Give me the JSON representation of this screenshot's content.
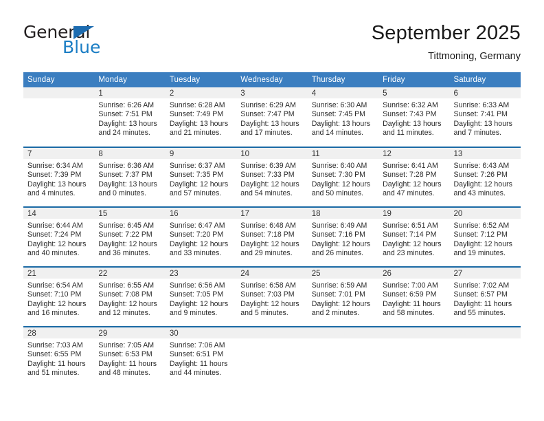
{
  "brand": {
    "name_top": "General",
    "name_bottom": "Blue",
    "triangle_icon": "triangle-icon",
    "color_dark": "#231f20",
    "color_blue": "#1a7dc4"
  },
  "header": {
    "title": "September 2025",
    "subtitle": "Tittmoning, Germany"
  },
  "theme": {
    "header_bg": "#3b7ec0",
    "row_border": "#1b6aa5",
    "daynum_bg": "#f0f0f0"
  },
  "weekdays": [
    "Sunday",
    "Monday",
    "Tuesday",
    "Wednesday",
    "Thursday",
    "Friday",
    "Saturday"
  ],
  "weeks": [
    [
      {
        "day": "",
        "sunrise": "",
        "sunset": "",
        "daylight1": "",
        "daylight2": "",
        "empty": true
      },
      {
        "day": "1",
        "sunrise": "Sunrise: 6:26 AM",
        "sunset": "Sunset: 7:51 PM",
        "daylight1": "Daylight: 13 hours",
        "daylight2": "and 24 minutes."
      },
      {
        "day": "2",
        "sunrise": "Sunrise: 6:28 AM",
        "sunset": "Sunset: 7:49 PM",
        "daylight1": "Daylight: 13 hours",
        "daylight2": "and 21 minutes."
      },
      {
        "day": "3",
        "sunrise": "Sunrise: 6:29 AM",
        "sunset": "Sunset: 7:47 PM",
        "daylight1": "Daylight: 13 hours",
        "daylight2": "and 17 minutes."
      },
      {
        "day": "4",
        "sunrise": "Sunrise: 6:30 AM",
        "sunset": "Sunset: 7:45 PM",
        "daylight1": "Daylight: 13 hours",
        "daylight2": "and 14 minutes."
      },
      {
        "day": "5",
        "sunrise": "Sunrise: 6:32 AM",
        "sunset": "Sunset: 7:43 PM",
        "daylight1": "Daylight: 13 hours",
        "daylight2": "and 11 minutes."
      },
      {
        "day": "6",
        "sunrise": "Sunrise: 6:33 AM",
        "sunset": "Sunset: 7:41 PM",
        "daylight1": "Daylight: 13 hours",
        "daylight2": "and 7 minutes."
      }
    ],
    [
      {
        "day": "7",
        "sunrise": "Sunrise: 6:34 AM",
        "sunset": "Sunset: 7:39 PM",
        "daylight1": "Daylight: 13 hours",
        "daylight2": "and 4 minutes."
      },
      {
        "day": "8",
        "sunrise": "Sunrise: 6:36 AM",
        "sunset": "Sunset: 7:37 PM",
        "daylight1": "Daylight: 13 hours",
        "daylight2": "and 0 minutes."
      },
      {
        "day": "9",
        "sunrise": "Sunrise: 6:37 AM",
        "sunset": "Sunset: 7:35 PM",
        "daylight1": "Daylight: 12 hours",
        "daylight2": "and 57 minutes."
      },
      {
        "day": "10",
        "sunrise": "Sunrise: 6:39 AM",
        "sunset": "Sunset: 7:33 PM",
        "daylight1": "Daylight: 12 hours",
        "daylight2": "and 54 minutes."
      },
      {
        "day": "11",
        "sunrise": "Sunrise: 6:40 AM",
        "sunset": "Sunset: 7:30 PM",
        "daylight1": "Daylight: 12 hours",
        "daylight2": "and 50 minutes."
      },
      {
        "day": "12",
        "sunrise": "Sunrise: 6:41 AM",
        "sunset": "Sunset: 7:28 PM",
        "daylight1": "Daylight: 12 hours",
        "daylight2": "and 47 minutes."
      },
      {
        "day": "13",
        "sunrise": "Sunrise: 6:43 AM",
        "sunset": "Sunset: 7:26 PM",
        "daylight1": "Daylight: 12 hours",
        "daylight2": "and 43 minutes."
      }
    ],
    [
      {
        "day": "14",
        "sunrise": "Sunrise: 6:44 AM",
        "sunset": "Sunset: 7:24 PM",
        "daylight1": "Daylight: 12 hours",
        "daylight2": "and 40 minutes."
      },
      {
        "day": "15",
        "sunrise": "Sunrise: 6:45 AM",
        "sunset": "Sunset: 7:22 PM",
        "daylight1": "Daylight: 12 hours",
        "daylight2": "and 36 minutes."
      },
      {
        "day": "16",
        "sunrise": "Sunrise: 6:47 AM",
        "sunset": "Sunset: 7:20 PM",
        "daylight1": "Daylight: 12 hours",
        "daylight2": "and 33 minutes."
      },
      {
        "day": "17",
        "sunrise": "Sunrise: 6:48 AM",
        "sunset": "Sunset: 7:18 PM",
        "daylight1": "Daylight: 12 hours",
        "daylight2": "and 29 minutes."
      },
      {
        "day": "18",
        "sunrise": "Sunrise: 6:49 AM",
        "sunset": "Sunset: 7:16 PM",
        "daylight1": "Daylight: 12 hours",
        "daylight2": "and 26 minutes."
      },
      {
        "day": "19",
        "sunrise": "Sunrise: 6:51 AM",
        "sunset": "Sunset: 7:14 PM",
        "daylight1": "Daylight: 12 hours",
        "daylight2": "and 23 minutes."
      },
      {
        "day": "20",
        "sunrise": "Sunrise: 6:52 AM",
        "sunset": "Sunset: 7:12 PM",
        "daylight1": "Daylight: 12 hours",
        "daylight2": "and 19 minutes."
      }
    ],
    [
      {
        "day": "21",
        "sunrise": "Sunrise: 6:54 AM",
        "sunset": "Sunset: 7:10 PM",
        "daylight1": "Daylight: 12 hours",
        "daylight2": "and 16 minutes."
      },
      {
        "day": "22",
        "sunrise": "Sunrise: 6:55 AM",
        "sunset": "Sunset: 7:08 PM",
        "daylight1": "Daylight: 12 hours",
        "daylight2": "and 12 minutes."
      },
      {
        "day": "23",
        "sunrise": "Sunrise: 6:56 AM",
        "sunset": "Sunset: 7:05 PM",
        "daylight1": "Daylight: 12 hours",
        "daylight2": "and 9 minutes."
      },
      {
        "day": "24",
        "sunrise": "Sunrise: 6:58 AM",
        "sunset": "Sunset: 7:03 PM",
        "daylight1": "Daylight: 12 hours",
        "daylight2": "and 5 minutes."
      },
      {
        "day": "25",
        "sunrise": "Sunrise: 6:59 AM",
        "sunset": "Sunset: 7:01 PM",
        "daylight1": "Daylight: 12 hours",
        "daylight2": "and 2 minutes."
      },
      {
        "day": "26",
        "sunrise": "Sunrise: 7:00 AM",
        "sunset": "Sunset: 6:59 PM",
        "daylight1": "Daylight: 11 hours",
        "daylight2": "and 58 minutes."
      },
      {
        "day": "27",
        "sunrise": "Sunrise: 7:02 AM",
        "sunset": "Sunset: 6:57 PM",
        "daylight1": "Daylight: 11 hours",
        "daylight2": "and 55 minutes."
      }
    ],
    [
      {
        "day": "28",
        "sunrise": "Sunrise: 7:03 AM",
        "sunset": "Sunset: 6:55 PM",
        "daylight1": "Daylight: 11 hours",
        "daylight2": "and 51 minutes."
      },
      {
        "day": "29",
        "sunrise": "Sunrise: 7:05 AM",
        "sunset": "Sunset: 6:53 PM",
        "daylight1": "Daylight: 11 hours",
        "daylight2": "and 48 minutes."
      },
      {
        "day": "30",
        "sunrise": "Sunrise: 7:06 AM",
        "sunset": "Sunset: 6:51 PM",
        "daylight1": "Daylight: 11 hours",
        "daylight2": "and 44 minutes."
      },
      {
        "day": "",
        "sunrise": "",
        "sunset": "",
        "daylight1": "",
        "daylight2": "",
        "empty": true
      },
      {
        "day": "",
        "sunrise": "",
        "sunset": "",
        "daylight1": "",
        "daylight2": "",
        "empty": true
      },
      {
        "day": "",
        "sunrise": "",
        "sunset": "",
        "daylight1": "",
        "daylight2": "",
        "empty": true
      },
      {
        "day": "",
        "sunrise": "",
        "sunset": "",
        "daylight1": "",
        "daylight2": "",
        "empty": true
      }
    ]
  ]
}
